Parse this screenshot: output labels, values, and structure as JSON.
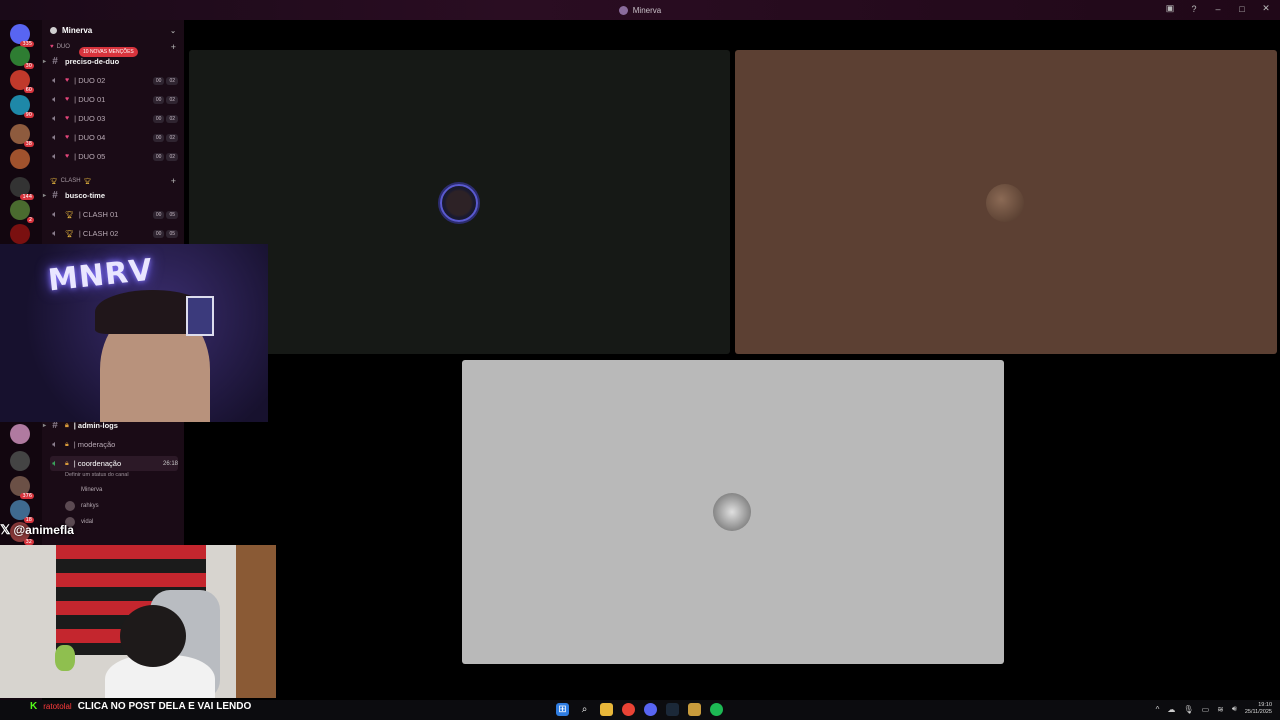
{
  "window": {
    "title": "Minerva"
  },
  "servers": [
    {
      "icon": "discord-home-icon",
      "badge": "335"
    },
    {
      "icon": "server-icon-1",
      "badge": "30"
    },
    {
      "icon": "server-icon-2",
      "badge": "60"
    },
    {
      "icon": "server-icon-3",
      "badge": "90"
    },
    {
      "icon": "server-icon-4",
      "badge": "38"
    },
    {
      "icon": "server-icon-5",
      "badge": ""
    },
    {
      "icon": "server-icon-6",
      "badge": "144"
    },
    {
      "icon": "server-icon-7",
      "badge": "2"
    },
    {
      "icon": "server-icon-8",
      "badge": ""
    }
  ],
  "servers_bottom": [
    {
      "icon": "server-icon-9",
      "badge": ""
    },
    {
      "icon": "server-icon-10",
      "badge": ""
    },
    {
      "icon": "server-icon-11",
      "badge": "376"
    },
    {
      "icon": "server-icon-12",
      "badge": "18"
    },
    {
      "icon": "server-icon-13",
      "badge": "32"
    }
  ],
  "sidebar": {
    "server_name": "Minerva",
    "mention_pill": "10 NOVAS MENÇÕES",
    "cat_duo": "DUO",
    "cat_clash": "CLASH",
    "channels": [
      {
        "name": "preciso-de-duo"
      },
      {
        "name": "| DUO 02",
        "a": "00",
        "b": "02"
      },
      {
        "name": "| DUO 01",
        "a": "00",
        "b": "02"
      },
      {
        "name": "| DUO 03",
        "a": "00",
        "b": "02"
      },
      {
        "name": "| DUO 04",
        "a": "00",
        "b": "02"
      },
      {
        "name": "| DUO 05",
        "a": "00",
        "b": "02"
      },
      {
        "name": "busco-time"
      },
      {
        "name": "| CLASH 01",
        "a": "00",
        "b": "05"
      },
      {
        "name": "| CLASH 02",
        "a": "00",
        "b": "05"
      }
    ],
    "staff": [
      {
        "name": "| admin-logs"
      },
      {
        "name": "| moderação"
      },
      {
        "name": "| coordenação",
        "time": "26:18"
      }
    ],
    "status_hint": "Definir um status do canal",
    "voice_users": [
      "Minerva",
      "rahkys",
      "vidal"
    ]
  },
  "overlay": {
    "neon_sign": "MNRV",
    "handle": "@animefla"
  },
  "chat": {
    "user": "ratotolal",
    "message": "CLICA NO POST DELA E VAI LENDO"
  },
  "tiles": [
    {
      "name": "user-tile-1"
    },
    {
      "name": "user-tile-2"
    },
    {
      "name": "user-tile-3"
    }
  ],
  "taskbar": {
    "time": "19:10",
    "date": "25/11/2025"
  },
  "colors": {
    "accent": "#d8343d",
    "tile_brown": "#5c4033",
    "tile_gray": "#b9b9b9",
    "tile_dark": "#161916"
  }
}
